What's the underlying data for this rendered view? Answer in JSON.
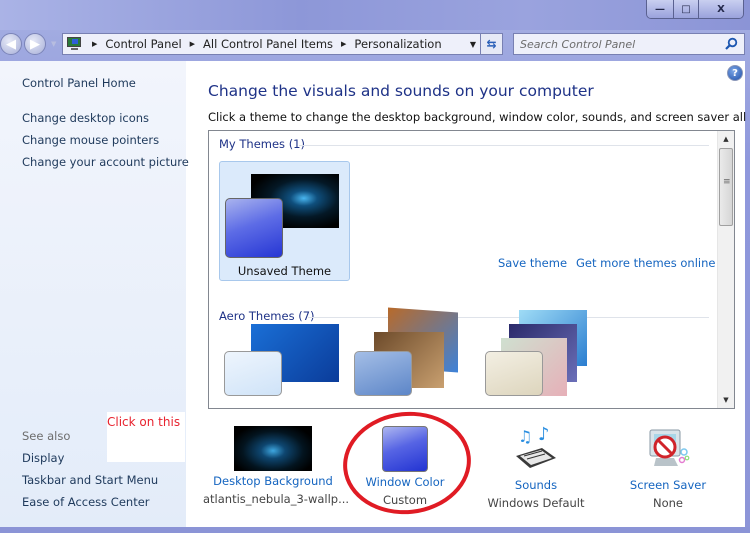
{
  "window": {
    "controls": {
      "minimize": "—",
      "maximize": "□",
      "close": "X"
    }
  },
  "nav": {
    "back_icon": "back-arrow-icon",
    "forward_icon": "forward-arrow-icon",
    "breadcrumb": [
      "Control Panel",
      "All Control Panel Items",
      "Personalization"
    ],
    "refresh_icon": "refresh-icon",
    "search_placeholder": "Search Control Panel"
  },
  "sidebar": {
    "home": "Control Panel Home",
    "tasks": [
      "Change desktop icons",
      "Change mouse pointers",
      "Change your account picture"
    ],
    "see_also_label": "See also",
    "see_also": [
      "Display",
      "Taskbar and Start Menu",
      "Ease of Access Center"
    ]
  },
  "annotation": {
    "note": "Click on this",
    "color": "#e01b24"
  },
  "main": {
    "title": "Change the visuals and sounds on your computer",
    "subtitle": "Click a theme to change the desktop background, window color, sounds, and screen saver all at once.",
    "my_themes_header": "My Themes (1)",
    "my_themes": [
      {
        "name": "Unsaved Theme",
        "selected": true
      }
    ],
    "save_theme": "Save theme",
    "get_more": "Get more themes online",
    "aero_header": "Aero Themes (7)",
    "aero_visible_count": 3
  },
  "settings": [
    {
      "label": "Desktop Background",
      "value": "atlantis_nebula_3-wallp...",
      "icon": "wallpaper-icon"
    },
    {
      "label": "Window Color",
      "value": "Custom",
      "icon": "window-color-icon"
    },
    {
      "label": "Sounds",
      "value": "Windows Default",
      "icon": "sounds-icon"
    },
    {
      "label": "Screen Saver",
      "value": "None",
      "icon": "screen-saver-icon"
    }
  ],
  "colors": {
    "link": "#1565c0",
    "heading": "#1e3287",
    "window_color": "#2a3fd6"
  }
}
